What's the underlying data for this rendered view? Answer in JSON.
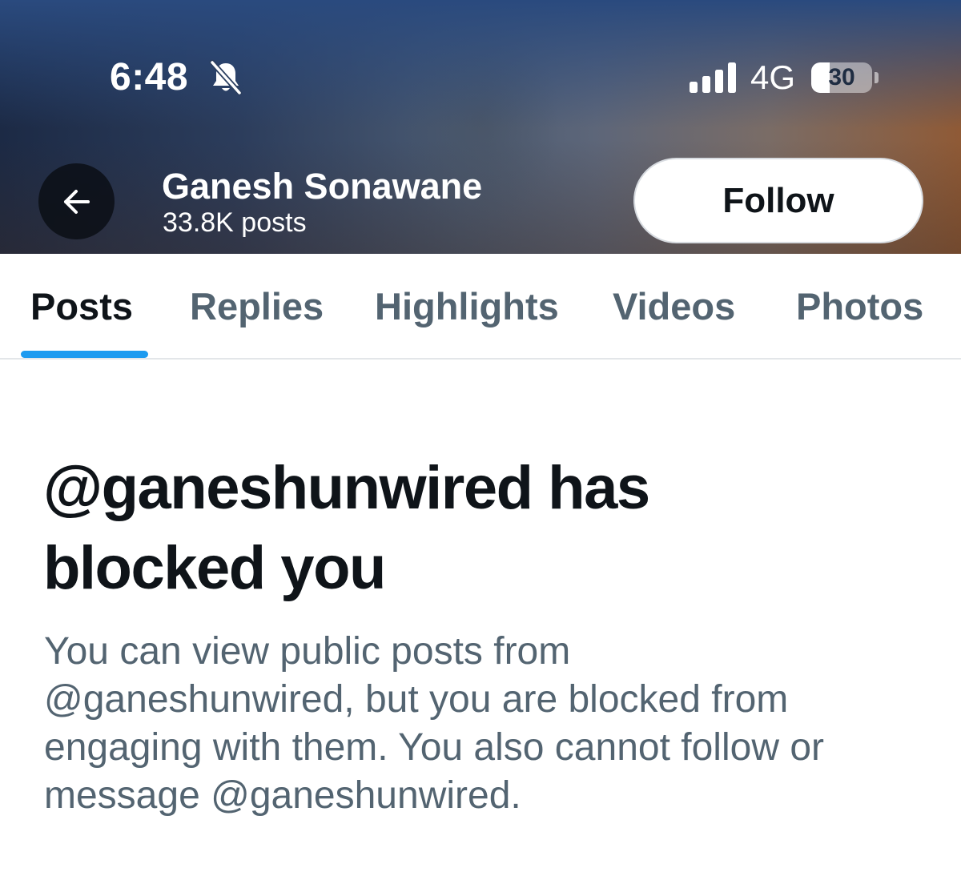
{
  "status_bar": {
    "time": "6:48",
    "network": "4G",
    "battery_level": "30",
    "battery_fraction": 0.3,
    "icons": [
      "bell-slash-icon",
      "signal-bars-icon",
      "battery-icon"
    ]
  },
  "header": {
    "back_icon": "arrow-left-icon",
    "name": "Ganesh Sonawane",
    "post_count": "33.8K posts",
    "follow_label": "Follow"
  },
  "tabs": [
    {
      "label": "Posts",
      "active": true
    },
    {
      "label": "Replies",
      "active": false
    },
    {
      "label": "Highlights",
      "active": false
    },
    {
      "label": "Videos",
      "active": false
    },
    {
      "label": "Photos",
      "active": false
    }
  ],
  "blocked": {
    "title_line1": "@ganeshunwired has",
    "title_line2": "blocked you",
    "body_line1": "You can view public posts from",
    "body_line2": "@ganeshunwired, but you are blocked from",
    "body_line3": "engaging with them. You also cannot follow or",
    "body_line4": "message @ganeshunwired."
  },
  "colors": {
    "accent": "#1d9bf0",
    "text_primary": "#0f1419",
    "text_secondary": "#536471"
  }
}
